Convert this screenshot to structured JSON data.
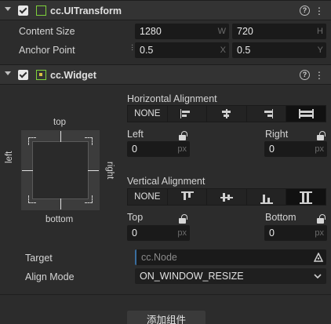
{
  "uitransform": {
    "title": "cc.UITransform",
    "help": "?",
    "more": "⋮",
    "content_size": {
      "label": "Content Size",
      "w_value": "1280",
      "w_unit": "W",
      "h_value": "720",
      "h_unit": "H"
    },
    "anchor_point": {
      "label": "Anchor Point",
      "x_value": "0.5",
      "x_unit": "X",
      "y_value": "0.5",
      "y_unit": "Y"
    }
  },
  "widget": {
    "title": "cc.Widget",
    "help": "?",
    "more": "⋮",
    "diagram": {
      "top": "top",
      "bottom": "bottom",
      "left": "left",
      "right": "right"
    },
    "horizontal": {
      "title": "Horizontal Alignment",
      "none_label": "NONE",
      "left_label": "Left",
      "left_value": "0",
      "left_unit": "px",
      "right_label": "Right",
      "right_value": "0",
      "right_unit": "px"
    },
    "vertical": {
      "title": "Vertical Alignment",
      "none_label": "NONE",
      "top_label": "Top",
      "top_value": "0",
      "top_unit": "px",
      "bottom_label": "Bottom",
      "bottom_value": "0",
      "bottom_unit": "px"
    },
    "target": {
      "label": "Target",
      "placeholder": "cc.Node"
    },
    "align_mode": {
      "label": "Align Mode",
      "value": "ON_WINDOW_RESIZE"
    }
  },
  "add_component_label": "添加组件"
}
